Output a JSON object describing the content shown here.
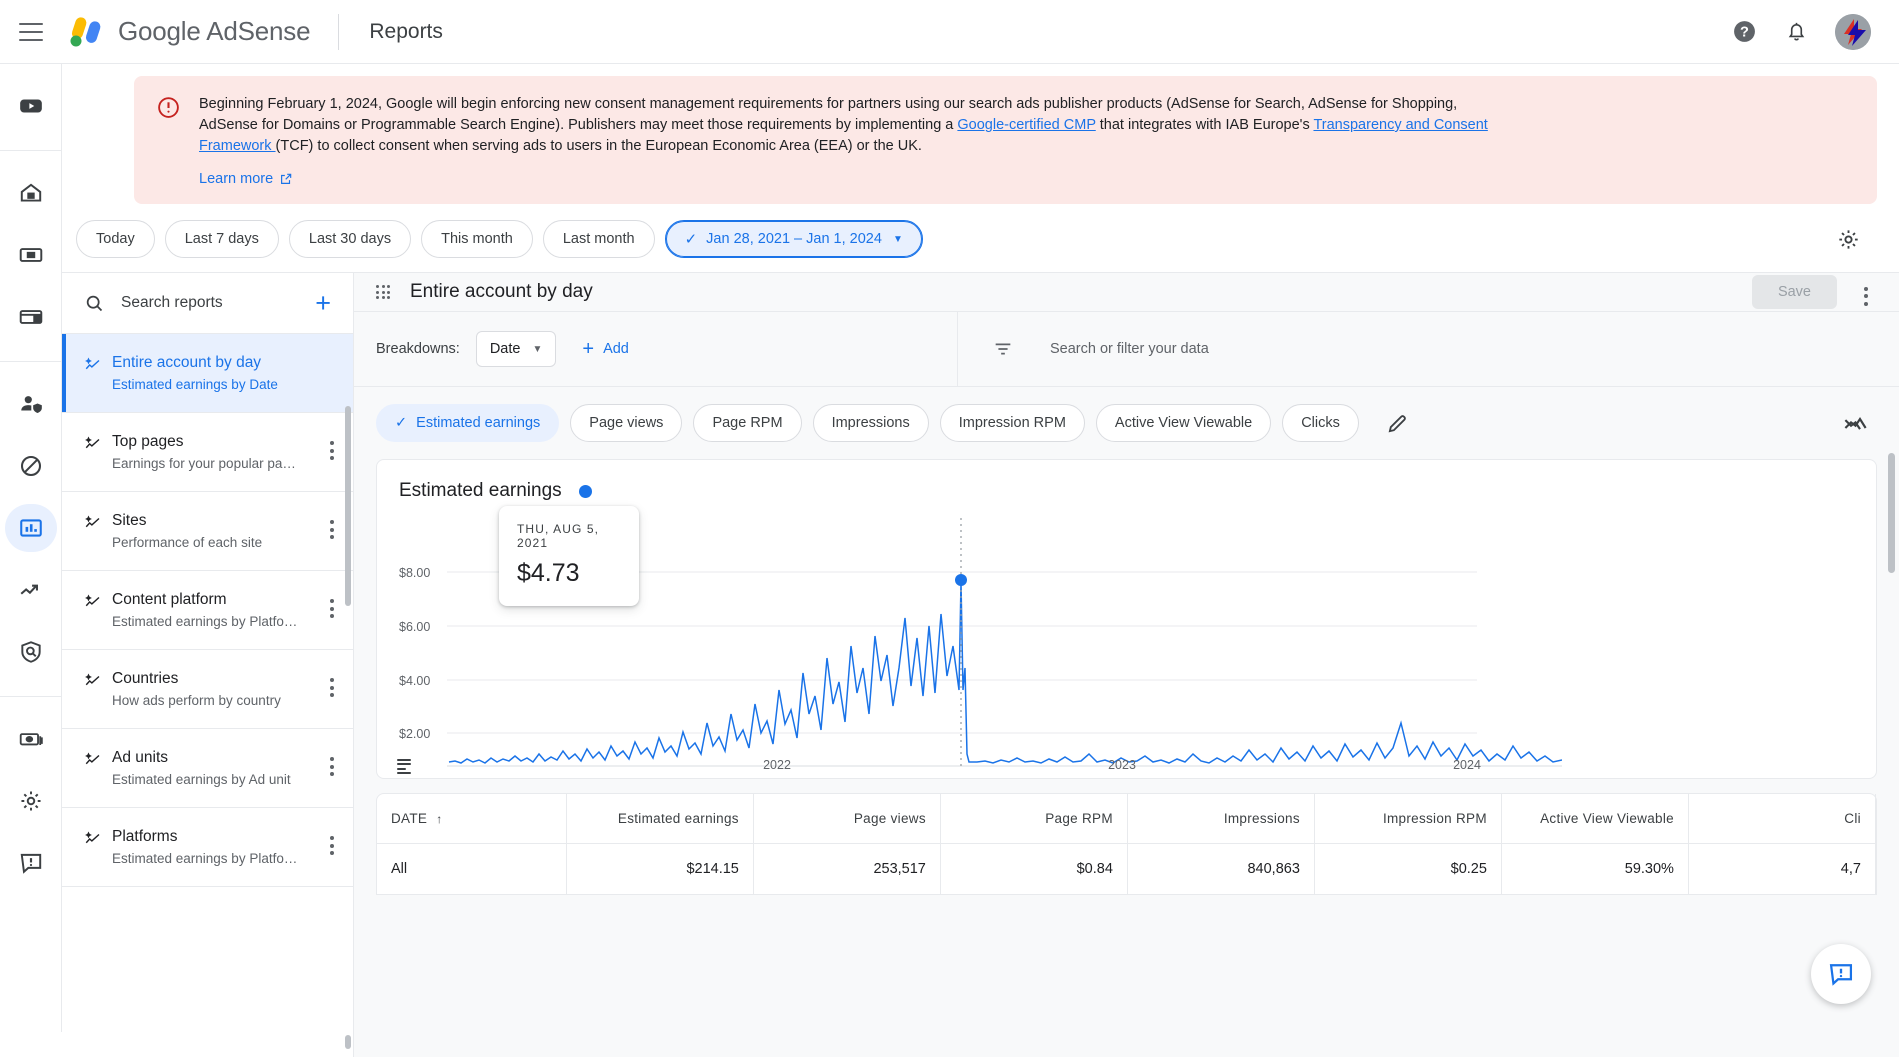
{
  "appbar": {
    "menu_icon": "hamburger-icon",
    "brand": "Google AdSense",
    "page_title": "Reports",
    "help_icon": "help-icon",
    "notifications_icon": "bell-icon",
    "avatar_icon": "account-avatar"
  },
  "rail": [
    {
      "name": "youtube",
      "icon": "youtube-icon"
    },
    {
      "name": "home",
      "icon": "home-icon"
    },
    {
      "name": "ads",
      "icon": "ads-icon"
    },
    {
      "name": "sites",
      "icon": "sites-icon"
    },
    {
      "name": "privacy-messaging",
      "icon": "person-shield-icon"
    },
    {
      "name": "blocking-controls",
      "icon": "block-icon"
    },
    {
      "name": "reports",
      "icon": "bar-chart-icon",
      "active": true
    },
    {
      "name": "optimization",
      "icon": "trending-up-icon"
    },
    {
      "name": "brand-safety",
      "icon": "shield-search-icon"
    },
    {
      "name": "payments",
      "icon": "money-icon"
    },
    {
      "name": "account-settings",
      "icon": "gear-icon"
    },
    {
      "name": "feedback",
      "icon": "feedback-icon"
    }
  ],
  "banner": {
    "icon": "alert-circle-icon",
    "line1_a": "Beginning February 1, 2024, Google will begin enforcing new consent management requirements for partners using our search ads publisher products (AdSense for Search, AdSense for Shopping, AdSense for Domains or Programmable Search Engine). Publishers may meet those requirements by implementing a ",
    "link1": "Google-certified CMP",
    "line1_b": " that integrates with IAB Europe's ",
    "link2": "Transparency and Consent Framework ",
    "line1_c": "(TCF) to collect consent when serving ads to users in the European Economic Area (EEA) or the UK.",
    "learn_more": "Learn more",
    "external_icon": "external-link-icon"
  },
  "date_chips": [
    {
      "label": "Today",
      "selected": false
    },
    {
      "label": "Last 7 days",
      "selected": false
    },
    {
      "label": "Last 30 days",
      "selected": false
    },
    {
      "label": "This month",
      "selected": false
    },
    {
      "label": "Last month",
      "selected": false
    },
    {
      "label": "Jan 28, 2021 – Jan 1, 2024",
      "selected": true
    }
  ],
  "settings_icon": "gear-icon",
  "sidebar": {
    "search_placeholder": "Search reports",
    "search_icon": "search-icon",
    "add_icon": "plus-icon",
    "items": [
      {
        "title": "Entire account by day",
        "subtitle": "Estimated earnings by Date",
        "active": true
      },
      {
        "title": "Top pages",
        "subtitle": "Earnings for your popular pa…",
        "active": false
      },
      {
        "title": "Sites",
        "subtitle": "Performance of each site",
        "active": false
      },
      {
        "title": "Content platform",
        "subtitle": "Estimated earnings by Platfo…",
        "active": false
      },
      {
        "title": "Countries",
        "subtitle": "How ads perform by country",
        "active": false
      },
      {
        "title": "Ad units",
        "subtitle": "Estimated earnings by Ad unit",
        "active": false
      },
      {
        "title": "Platforms",
        "subtitle": "Estimated earnings by Platfo…",
        "active": false
      }
    ]
  },
  "panel": {
    "title": "Entire account by day",
    "save_label": "Save",
    "drag_icon": "drag-handle-icon",
    "kebab_icon": "more-vert-icon",
    "breakdowns_label": "Breakdowns:",
    "breakdown_value": "Date",
    "add_label": "Add",
    "filter_icon": "filter-icon",
    "filter_placeholder": "Search or filter your data",
    "edit_icon": "pencil-icon",
    "chart_type_icon": "line-chart-icon",
    "metrics": [
      {
        "label": "Estimated earnings",
        "selected": true
      },
      {
        "label": "Page views",
        "selected": false
      },
      {
        "label": "Page RPM",
        "selected": false
      },
      {
        "label": "Impressions",
        "selected": false
      },
      {
        "label": "Impression RPM",
        "selected": false
      },
      {
        "label": "Active View Viewable",
        "selected": false
      },
      {
        "label": "Clicks",
        "selected": false
      }
    ]
  },
  "chart_data": {
    "type": "line",
    "title": "Estimated earnings",
    "legend": [
      "Estimated earnings"
    ],
    "series_color": "#1a73e8",
    "xlabel": "",
    "ylabel": "",
    "ylim": [
      0,
      9
    ],
    "yticks": [
      "$2.00",
      "$4.00",
      "$6.00",
      "$8.00"
    ],
    "ytick_values": [
      2,
      4,
      6,
      8
    ],
    "xticks": [
      "2022",
      "2023",
      "2024"
    ],
    "x_range": [
      "Jan 28, 2021",
      "Jan 1, 2024"
    ],
    "grid": true,
    "tooltip": {
      "date": "THU, AUG 5, 2021",
      "value": "$4.73",
      "value_number": 4.73
    },
    "highlight_point": {
      "x": "2021-08-05",
      "y": 4.73
    },
    "menu_icon": "chart-menu-icon",
    "notes": "Daily estimated earnings; gradual rise through mid-2021 peaking at $4.73 on Aug 5, 2021, then a sharp drop to a low baseline with small daily noise through 2022-2024, with a modest rise near the end of 2023."
  },
  "table": {
    "columns": [
      {
        "label": "DATE",
        "align": "left",
        "sorted": true,
        "sort_icon": "arrow-up-icon"
      },
      {
        "label": "Estimated earnings",
        "align": "right"
      },
      {
        "label": "Page views",
        "align": "right"
      },
      {
        "label": "Page RPM",
        "align": "right"
      },
      {
        "label": "Impressions",
        "align": "right"
      },
      {
        "label": "Impression RPM",
        "align": "right"
      },
      {
        "label": "Active View Viewable",
        "align": "right"
      },
      {
        "label": "Cli",
        "align": "right"
      }
    ],
    "rows": [
      {
        "cells": [
          "All",
          "$214.15",
          "253,517",
          "$0.84",
          "840,863",
          "$0.25",
          "59.30%",
          "4,7"
        ]
      }
    ]
  },
  "fab": {
    "icon": "feedback-icon"
  },
  "colors": {
    "accent": "#1a73e8",
    "banner_bg": "#fce8e6",
    "panel_bg": "#f8f9fa",
    "border": "#e8eaed"
  }
}
